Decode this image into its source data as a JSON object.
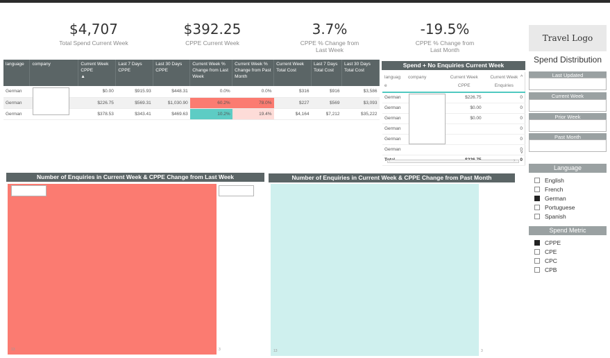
{
  "kpis": [
    {
      "value": "$4,707",
      "label": "Total Spend Current Week"
    },
    {
      "value": "$392.25",
      "label": "CPPE Current Week"
    },
    {
      "value": "3.7%",
      "label_line1": "CPPE % Change from",
      "label_line2": "Last Week"
    },
    {
      "value": "-19.5%",
      "label_line1": "CPPE % Change from",
      "label_line2": "Last Month"
    }
  ],
  "table1": {
    "headers": [
      "language",
      "company",
      "Current Week CPPE",
      "Last 7 Days CPPE",
      "Last 30 Days CPPE",
      "Current Week % Change from Last Week",
      "Current Week % Change from Past Month",
      "Current Week Total Cost",
      "Last 7 Days Total Cost",
      "Last 30 Days Total Cost"
    ],
    "sort_arrow": "▲",
    "rows": [
      [
        "German",
        "",
        "$0.00",
        "$915.93",
        "$448.31",
        "0.0%",
        "0.0%",
        "$316",
        "$916",
        "$3,586"
      ],
      [
        "German",
        "",
        "$226.75",
        "$569.31",
        "$1,030.90",
        "60.2%",
        "78.0%",
        "$227",
        "$569",
        "$3,093"
      ],
      [
        "German",
        "",
        "$378.53",
        "$343.41",
        "$469.63",
        "10.2%",
        "19.4%",
        "$4,164",
        "$7,212",
        "$35,222"
      ]
    ],
    "colors": {
      "red": "#fb7b71",
      "pink": "#fddcd8",
      "teal": "#5dccc4"
    }
  },
  "table2": {
    "title": "Spend + No Enquiries Current Week",
    "headers": [
      "languag e",
      "company",
      "Current Week CPPE",
      "Current Week Enquiries"
    ],
    "rows": [
      [
        "German",
        "",
        "$226.75",
        "0"
      ],
      [
        "German",
        "",
        "$0.00",
        "0"
      ],
      [
        "German",
        "",
        "$0.00",
        "0"
      ],
      [
        "German",
        "",
        "",
        "0"
      ],
      [
        "German",
        "",
        "",
        "0"
      ],
      [
        "German",
        "",
        "",
        "0"
      ]
    ],
    "total": [
      "Total",
      "",
      "$226.75",
      "0"
    ]
  },
  "sidebar": {
    "logo": "Travel Logo",
    "title": "Spend Distribution",
    "fields": [
      "Last Updated",
      "Current Week",
      "Prior Week",
      "Past Month"
    ],
    "language_header": "Language",
    "languages": [
      {
        "label": "English",
        "checked": false
      },
      {
        "label": "French",
        "checked": false
      },
      {
        "label": "German",
        "checked": true
      },
      {
        "label": "Portuguese",
        "checked": false
      },
      {
        "label": "Spanish",
        "checked": false
      }
    ],
    "metric_header": "Spend Metric",
    "metrics": [
      {
        "label": "CPPE",
        "checked": true
      },
      {
        "label": "CPE",
        "checked": false
      },
      {
        "label": "CPC",
        "checked": false
      },
      {
        "label": "CPB",
        "checked": false
      }
    ]
  },
  "charts": [
    {
      "title": "Number of Enquiries in Current Week & CPPE Change from Last Week",
      "color": "#fb7b71",
      "corner_label": "13",
      "side_label": "3"
    },
    {
      "title": "Number of Enquiries in Current Week & CPPE Change from Past Month",
      "color": "#cff0ee",
      "corner_label": "13",
      "side_label": "3"
    }
  ]
}
